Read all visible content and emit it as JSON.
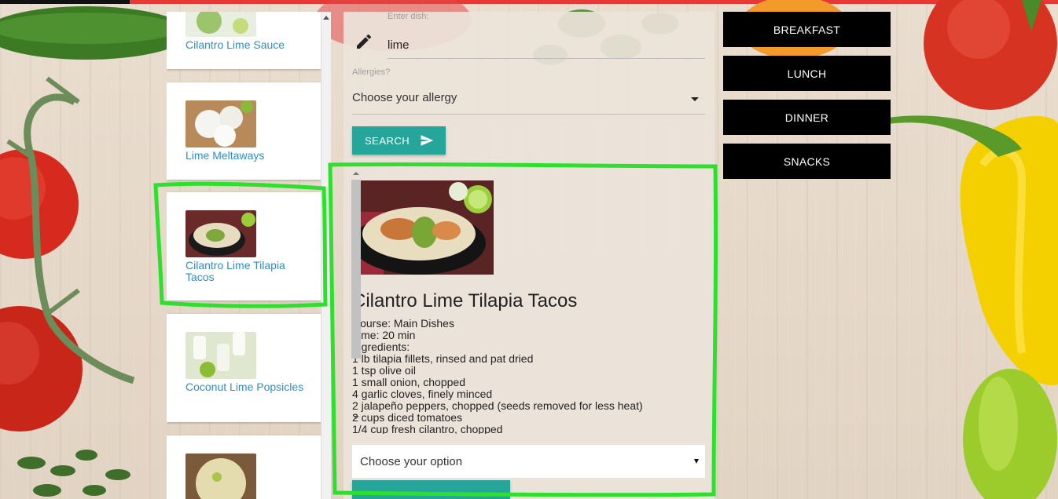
{
  "sidebar": {
    "items": [
      {
        "title": "Cilantro Lime Sauce"
      },
      {
        "title": "Lime Meltaways"
      },
      {
        "title": "Cilantro Lime Tilapia Tacos"
      },
      {
        "title": "Coconut Lime Popsicles"
      },
      {
        "title": ""
      }
    ]
  },
  "search": {
    "dish_label": "Enter dish:",
    "dish_value": "lime",
    "allergy_label": "Allergies?",
    "allergy_value": "Choose your allergy",
    "button_label": "SEARCH"
  },
  "recipe": {
    "title": "Cilantro Lime Tilapia Tacos",
    "course": "Course: Main Dishes",
    "time": "Time: 20 min",
    "ingredients_label": "Ingredients:",
    "ingredients": [
      "1 lb tilapia fillets, rinsed and pat dried",
      "1 tsp olive oil",
      "1 small onion, chopped",
      "4 garlic cloves, finely minced",
      "2 jalapeño peppers, chopped (seeds removed for less heat)",
      "2 cups diced tomatoes",
      "1/4 cup fresh cilantro, chopped"
    ],
    "option_value": "Choose your option"
  },
  "meals": {
    "breakfast": "BREAKFAST",
    "lunch": "LUNCH",
    "dinner": "DINNER",
    "snacks": "SNACKS"
  },
  "colors": {
    "accent": "#26a69a",
    "link": "#2e8fc6",
    "highlight": "#2ee02e",
    "meal_button": "#000000"
  },
  "icons": {
    "pencil": "pencil-icon",
    "send": "send-icon"
  }
}
